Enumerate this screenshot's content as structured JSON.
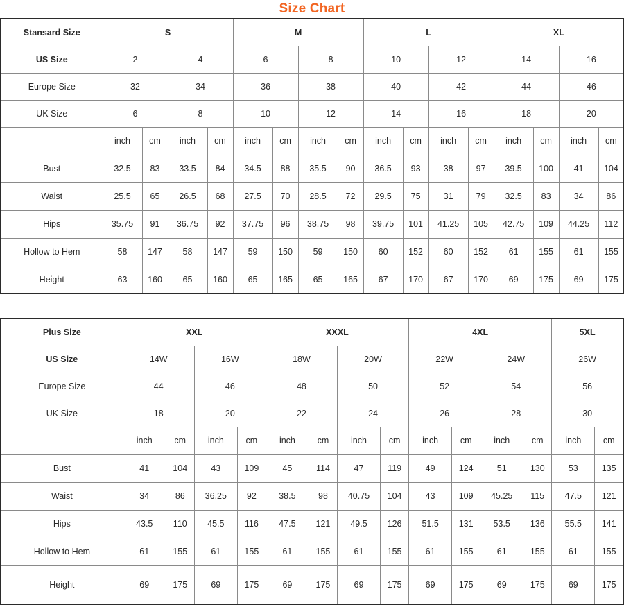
{
  "title": "Size Chart",
  "theme": {
    "title_color": "#F26522",
    "border_color": "#2b2b2b",
    "grid_color": "#8a8a8a"
  },
  "units": {
    "inch": "inch",
    "cm": "cm"
  },
  "standard_table": {
    "corner_label": "Stansard Size",
    "groups": [
      "S",
      "M",
      "L",
      "XL"
    ],
    "rows": [
      {
        "label": "US Size",
        "bold": true,
        "values": [
          "2",
          "4",
          "6",
          "8",
          "10",
          "12",
          "14",
          "16"
        ]
      },
      {
        "label": "Europe Size",
        "bold": false,
        "values": [
          "32",
          "34",
          "36",
          "38",
          "40",
          "42",
          "44",
          "46"
        ]
      },
      {
        "label": "UK Size",
        "bold": false,
        "values": [
          "6",
          "8",
          "10",
          "12",
          "14",
          "16",
          "18",
          "20"
        ]
      }
    ],
    "unit_row": [
      "inch",
      "cm",
      "inch",
      "cm",
      "inch",
      "cm",
      "inch",
      "cm",
      "inch",
      "cm",
      "inch",
      "cm",
      "inch",
      "cm",
      "inch",
      "cm"
    ],
    "measurements": [
      {
        "label": "Bust",
        "values": [
          "32.5",
          "83",
          "33.5",
          "84",
          "34.5",
          "88",
          "35.5",
          "90",
          "36.5",
          "93",
          "38",
          "97",
          "39.5",
          "100",
          "41",
          "104"
        ]
      },
      {
        "label": "Waist",
        "values": [
          "25.5",
          "65",
          "26.5",
          "68",
          "27.5",
          "70",
          "28.5",
          "72",
          "29.5",
          "75",
          "31",
          "79",
          "32.5",
          "83",
          "34",
          "86"
        ]
      },
      {
        "label": "Hips",
        "values": [
          "35.75",
          "91",
          "36.75",
          "92",
          "37.75",
          "96",
          "38.75",
          "98",
          "39.75",
          "101",
          "41.25",
          "105",
          "42.75",
          "109",
          "44.25",
          "112"
        ]
      },
      {
        "label": "Hollow to Hem",
        "values": [
          "58",
          "147",
          "58",
          "147",
          "59",
          "150",
          "59",
          "150",
          "60",
          "152",
          "60",
          "152",
          "61",
          "155",
          "61",
          "155"
        ]
      },
      {
        "label": "Height",
        "values": [
          "63",
          "160",
          "65",
          "160",
          "65",
          "165",
          "65",
          "165",
          "67",
          "170",
          "67",
          "170",
          "69",
          "175",
          "69",
          "175"
        ]
      }
    ]
  },
  "plus_table": {
    "corner_label": "Plus Size",
    "groups": [
      {
        "label": "XXL",
        "span": 2
      },
      {
        "label": "XXXL",
        "span": 2
      },
      {
        "label": "4XL",
        "span": 2
      },
      {
        "label": "5XL",
        "span": 1
      }
    ],
    "rows": [
      {
        "label": "US Size",
        "bold": true,
        "values": [
          "14W",
          "16W",
          "18W",
          "20W",
          "22W",
          "24W",
          "26W"
        ]
      },
      {
        "label": "Europe Size",
        "bold": false,
        "values": [
          "44",
          "46",
          "48",
          "50",
          "52",
          "54",
          "56"
        ]
      },
      {
        "label": "UK Size",
        "bold": false,
        "values": [
          "18",
          "20",
          "22",
          "24",
          "26",
          "28",
          "30"
        ]
      }
    ],
    "unit_row": [
      "inch",
      "cm",
      "inch",
      "cm",
      "inch",
      "cm",
      "inch",
      "cm",
      "inch",
      "cm",
      "inch",
      "cm",
      "inch",
      "cm"
    ],
    "measurements": [
      {
        "label": "Bust",
        "values": [
          "41",
          "104",
          "43",
          "109",
          "45",
          "114",
          "47",
          "119",
          "49",
          "124",
          "51",
          "130",
          "53",
          "135"
        ]
      },
      {
        "label": "Waist",
        "values": [
          "34",
          "86",
          "36.25",
          "92",
          "38.5",
          "98",
          "40.75",
          "104",
          "43",
          "109",
          "45.25",
          "115",
          "47.5",
          "121"
        ]
      },
      {
        "label": "Hips",
        "values": [
          "43.5",
          "110",
          "45.5",
          "116",
          "47.5",
          "121",
          "49.5",
          "126",
          "51.5",
          "131",
          "53.5",
          "136",
          "55.5",
          "141"
        ]
      },
      {
        "label": "Hollow to Hem",
        "values": [
          "61",
          "155",
          "61",
          "155",
          "61",
          "155",
          "61",
          "155",
          "61",
          "155",
          "61",
          "155",
          "61",
          "155"
        ]
      },
      {
        "label": "Height",
        "values": [
          "69",
          "175",
          "69",
          "175",
          "69",
          "175",
          "69",
          "175",
          "69",
          "175",
          "69",
          "175",
          "69",
          "175"
        ]
      }
    ]
  }
}
